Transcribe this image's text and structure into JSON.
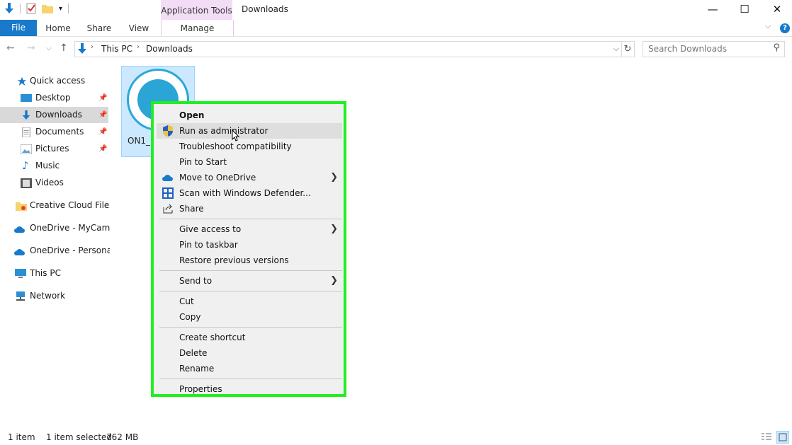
{
  "window": {
    "title": "Downloads",
    "minimize": "—",
    "maximize": "☐",
    "close": "✕"
  },
  "ribbon": {
    "context_group": "Application Tools",
    "tabs": [
      "File",
      "Home",
      "Share",
      "View",
      "Manage"
    ],
    "help": "?"
  },
  "address": {
    "crumbs": [
      "This PC",
      "Downloads"
    ],
    "search_placeholder": "Search Downloads"
  },
  "nav": {
    "quick_access": "Quick access",
    "items": [
      "Desktop",
      "Downloads",
      "Documents",
      "Pictures",
      "Music",
      "Videos"
    ],
    "creative_cloud": "Creative Cloud Files",
    "onedrive_campus": "OneDrive - MyCampus",
    "onedrive_personal": "OneDrive - Personal",
    "this_pc": "This PC",
    "network": "Network"
  },
  "file": {
    "label": "ON1_"
  },
  "context_menu": {
    "items": [
      {
        "label": "Open",
        "bold": true
      },
      {
        "label": "Run as administrator",
        "highlight": true,
        "icon": "shield-icon"
      },
      {
        "label": "Troubleshoot compatibility"
      },
      {
        "label": "Pin to Start"
      },
      {
        "label": "Move to OneDrive",
        "icon": "onedrive-icon",
        "submenu": true
      },
      {
        "label": "Scan with Windows Defender...",
        "icon": "defender-icon"
      },
      {
        "label": "Share",
        "icon": "share-icon"
      },
      {
        "label": "Give access to",
        "submenu": true
      },
      {
        "label": "Pin to taskbar"
      },
      {
        "label": "Restore previous versions"
      },
      {
        "label": "Send to",
        "submenu": true
      },
      {
        "label": "Cut"
      },
      {
        "label": "Copy"
      },
      {
        "label": "Create shortcut"
      },
      {
        "label": "Delete"
      },
      {
        "label": "Rename"
      },
      {
        "label": "Properties"
      }
    ]
  },
  "status": {
    "count": "1 item",
    "selected": "1 item selected",
    "size": "762 MB"
  },
  "colors": {
    "accent": "#1979ca",
    "highlight_border": "#22ee22",
    "selection": "#cce8ff"
  }
}
